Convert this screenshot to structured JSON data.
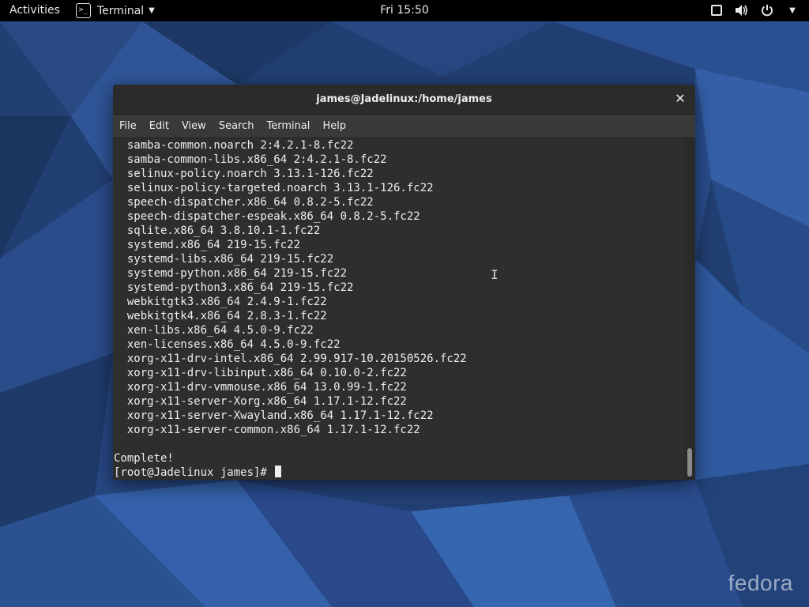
{
  "topbar": {
    "activities": "Activities",
    "app_name": "Terminal",
    "app_icon_glyph": ">_",
    "clock": "Fri 15:50",
    "status_icons": [
      "window-icon",
      "volume-icon",
      "power-icon",
      "chevron-down-icon"
    ]
  },
  "window": {
    "title": "james@Jadelinux:/home/james",
    "close_glyph": "✕",
    "menu": [
      "File",
      "Edit",
      "View",
      "Search",
      "Terminal",
      "Help"
    ]
  },
  "terminal": {
    "lines": [
      "  samba-common.noarch 2:4.2.1-8.fc22",
      "  samba-common-libs.x86_64 2:4.2.1-8.fc22",
      "  selinux-policy.noarch 3.13.1-126.fc22",
      "  selinux-policy-targeted.noarch 3.13.1-126.fc22",
      "  speech-dispatcher.x86_64 0.8.2-5.fc22",
      "  speech-dispatcher-espeak.x86_64 0.8.2-5.fc22",
      "  sqlite.x86_64 3.8.10.1-1.fc22",
      "  systemd.x86_64 219-15.fc22",
      "  systemd-libs.x86_64 219-15.fc22",
      "  systemd-python.x86_64 219-15.fc22",
      "  systemd-python3.x86_64 219-15.fc22",
      "  webkitgtk3.x86_64 2.4.9-1.fc22",
      "  webkitgtk4.x86_64 2.8.3-1.fc22",
      "  xen-libs.x86_64 4.5.0-9.fc22",
      "  xen-licenses.x86_64 4.5.0-9.fc22",
      "  xorg-x11-drv-intel.x86_64 2.99.917-10.20150526.fc22",
      "  xorg-x11-drv-libinput.x86_64 0.10.0-2.fc22",
      "  xorg-x11-drv-vmmouse.x86_64 13.0.99-1.fc22",
      "  xorg-x11-server-Xorg.x86_64 1.17.1-12.fc22",
      "  xorg-x11-server-Xwayland.x86_64 1.17.1-12.fc22",
      "  xorg-x11-server-common.x86_64 1.17.1-12.fc22",
      "",
      "Complete!"
    ],
    "prompt": "[root@Jadelinux james]# "
  },
  "desktop": {
    "logo_text": "fedora"
  },
  "colors": {
    "topbar_bg": "#000000",
    "terminal_bg": "#2e2e2e",
    "terminal_fg": "#eeeeec",
    "wallpaper_base": "#1f3e74"
  }
}
